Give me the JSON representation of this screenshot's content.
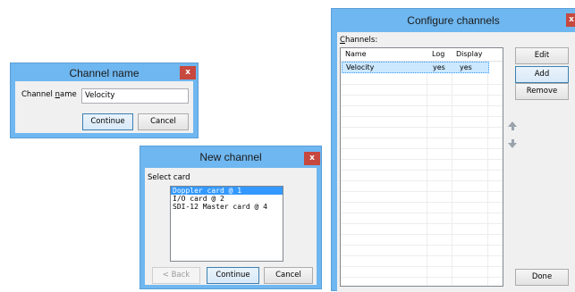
{
  "channel_name_dialog": {
    "title": "Channel name",
    "close_label": "x",
    "field_label_pre": "Channel ",
    "field_label_underlined": "n",
    "field_label_post": "ame",
    "field_value": "Velocity",
    "continue_label": "Continue",
    "cancel_label": "Cancel"
  },
  "new_channel_dialog": {
    "title": "New channel",
    "close_label": "x",
    "select_label": "Select card",
    "cards": [
      "Doppler card @ 1",
      "I/O card @ 2",
      "SDI-12 Master card @ 4"
    ],
    "back_label": "< Back",
    "continue_label": "Continue",
    "cancel_label": "Cancel"
  },
  "configure_dialog": {
    "title": "Configure channels",
    "close_label": "x",
    "channels_label_underlined": "C",
    "channels_label_rest": "hannels:",
    "columns": [
      "Name",
      "Log",
      "Display"
    ],
    "rows": [
      {
        "name": "Velocity",
        "log": "yes",
        "display": "yes"
      }
    ],
    "edit_label": "Edit",
    "add_label": "Add",
    "remove_label": "Remove",
    "done_label": "Done",
    "move_up_icon": "arrow-up-icon",
    "move_down_icon": "arrow-down-icon"
  }
}
